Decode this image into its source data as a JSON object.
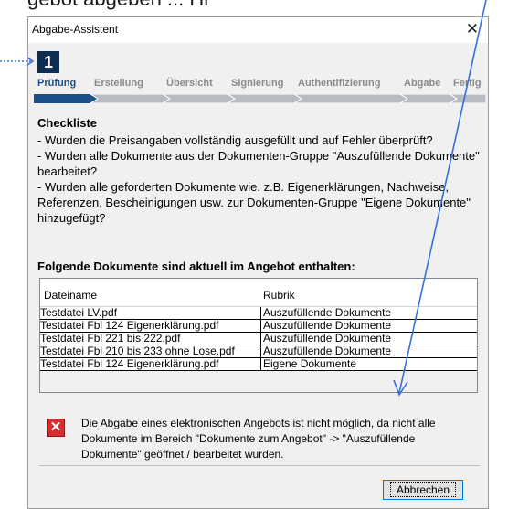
{
  "background": {
    "caption": "gebot abgeben ... Hi"
  },
  "window": {
    "title": "Abgabe-Assistent",
    "close_symbol": "✕"
  },
  "wizard": {
    "current_step_number": "1",
    "steps": [
      "Prüfung",
      "Erstellung",
      "Übersicht",
      "Signierung",
      "Authentifizierung",
      "Abgabe",
      "Fertig"
    ],
    "active_step_index": 0
  },
  "checklist": {
    "heading": "Checkliste",
    "lines": [
      "- Wurden die Preisangaben vollständig ausgefüllt und auf Fehler überprüft?",
      "- Wurden alle Dokumente aus der Dokumenten-Gruppe \"Auszufüllende Dokumente\" bearbeitet?",
      "- Wurden alle geforderten Dokumente wie. z.B. Eigenerklärungen, Nachweise, Referenzen, Bescheinigungen usw. zur Dokumenten-Gruppe \"Eigene Dokumente\" hinzugefügt?"
    ]
  },
  "documents": {
    "heading": "Folgende Dokumente sind aktuell im Angebot enthalten:",
    "columns": [
      "Dateiname",
      "Rubrik"
    ],
    "rows": [
      [
        "Testdatei LV.pdf",
        "Auszufüllende Dokumente"
      ],
      [
        "Testdatei Fbl 124 Eigenerklärung.pdf",
        "Auszufüllende Dokumente"
      ],
      [
        "Testdatei Fbl 221 bis 222.pdf",
        "Auszufüllende Dokumente"
      ],
      [
        "Testdatei Fbl 210 bis 233 ohne Lose.pdf",
        "Auszufüllende Dokumente"
      ],
      [
        "Testdatei Fbl 124 Eigenerklärung.pdf",
        "Eigene Dokumente"
      ]
    ]
  },
  "message": {
    "icon": "error-x-icon",
    "text": "Die Abgabe eines elektronischen Angebots ist nicht möglich, da nicht alle Dokumente im Bereich \"Dokumente zum Angebot\" -> \"Auszufüllende Dokumente\" geöffnet / bearbeitet wurden."
  },
  "buttons": {
    "cancel_label": "Abbrechen"
  },
  "colors": {
    "step_active": "#1a4f8a",
    "step_box": "#0d2d52",
    "error": "#d32f2f",
    "arrow": "#3a6fd8"
  }
}
